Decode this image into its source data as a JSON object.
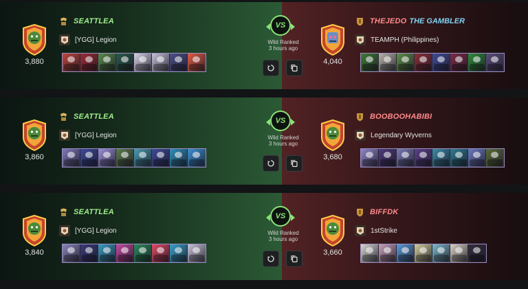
{
  "battles": [
    {
      "left": {
        "name": "SEATTLEA",
        "guild": "[YGG] Legion",
        "rating": "3,880",
        "team": [
          "#c1443c",
          "#9f2b34",
          "#5a8a4a",
          "#2a5a48",
          "#d9d4e6",
          "#c7c2d9",
          "#4b4f86",
          "#e05a44"
        ]
      },
      "right": {
        "name": "THEJEDO",
        "title": "THE GAMBLER",
        "guild": "TEAMPH (Philippines)",
        "rating": "4,040",
        "team": [
          "#3e7a36",
          "#b7b3a8",
          "#5e8e4a",
          "#8a2f3a",
          "#414a96",
          "#7a2c47",
          "#2f8a3a",
          "#5a4d78"
        ]
      },
      "center": {
        "vs": "VS",
        "format": "Wild Ranked",
        "time": "3 hours ago"
      }
    },
    {
      "left": {
        "name": "SEATTLEA",
        "guild": "[YGG] Legion",
        "rating": "3,860",
        "team": [
          "#7e78b8",
          "#3c4a9a",
          "#9a8ed8",
          "#5a7a4e",
          "#4a9ab0",
          "#3e4a96",
          "#2f8fba",
          "#3a8fd0"
        ]
      },
      "right": {
        "name": "BOOBOOHABIBI",
        "guild": "Legendary Wyverns",
        "rating": "3,680",
        "team": [
          "#8e84c6",
          "#4e3a7a",
          "#7a7ab6",
          "#5a4088",
          "#3a8aa6",
          "#2c7a8e",
          "#6a7ac0",
          "#5a6a3a"
        ]
      },
      "center": {
        "vs": "VS",
        "format": "Wild Ranked",
        "time": "3 hours ago"
      }
    },
    {
      "left": {
        "name": "SEATTLEA",
        "guild": "[YGG] Legion",
        "rating": "3,840",
        "team": [
          "#8a84b8",
          "#3a3a7a",
          "#3a9ac0",
          "#c44aa0",
          "#2a8a5a",
          "#e04a64",
          "#38a0c8",
          "#c8c4d8"
        ]
      },
      "right": {
        "name": "BIFFDK",
        "guild": "1stStrike",
        "rating": "3,660",
        "team": [
          "#d8d6d0",
          "#c7a0ba",
          "#5a9ad8",
          "#d0cc9a",
          "#7ab8c8",
          "#d8d0c0",
          "#322c3a"
        ]
      },
      "center": {
        "vs": "VS",
        "format": "Wild Ranked",
        "time": "3 hours ago"
      }
    }
  ],
  "icons": {
    "avatar": "orc-shield-avatar-icon",
    "rank_left": "rank-emblem-icon",
    "replay": "replay-icon",
    "copy": "copy-icon"
  },
  "colors": {
    "win_green": "#8be276",
    "lose_red": "#ff8a8a",
    "title_blue": "#7fd2f0"
  }
}
